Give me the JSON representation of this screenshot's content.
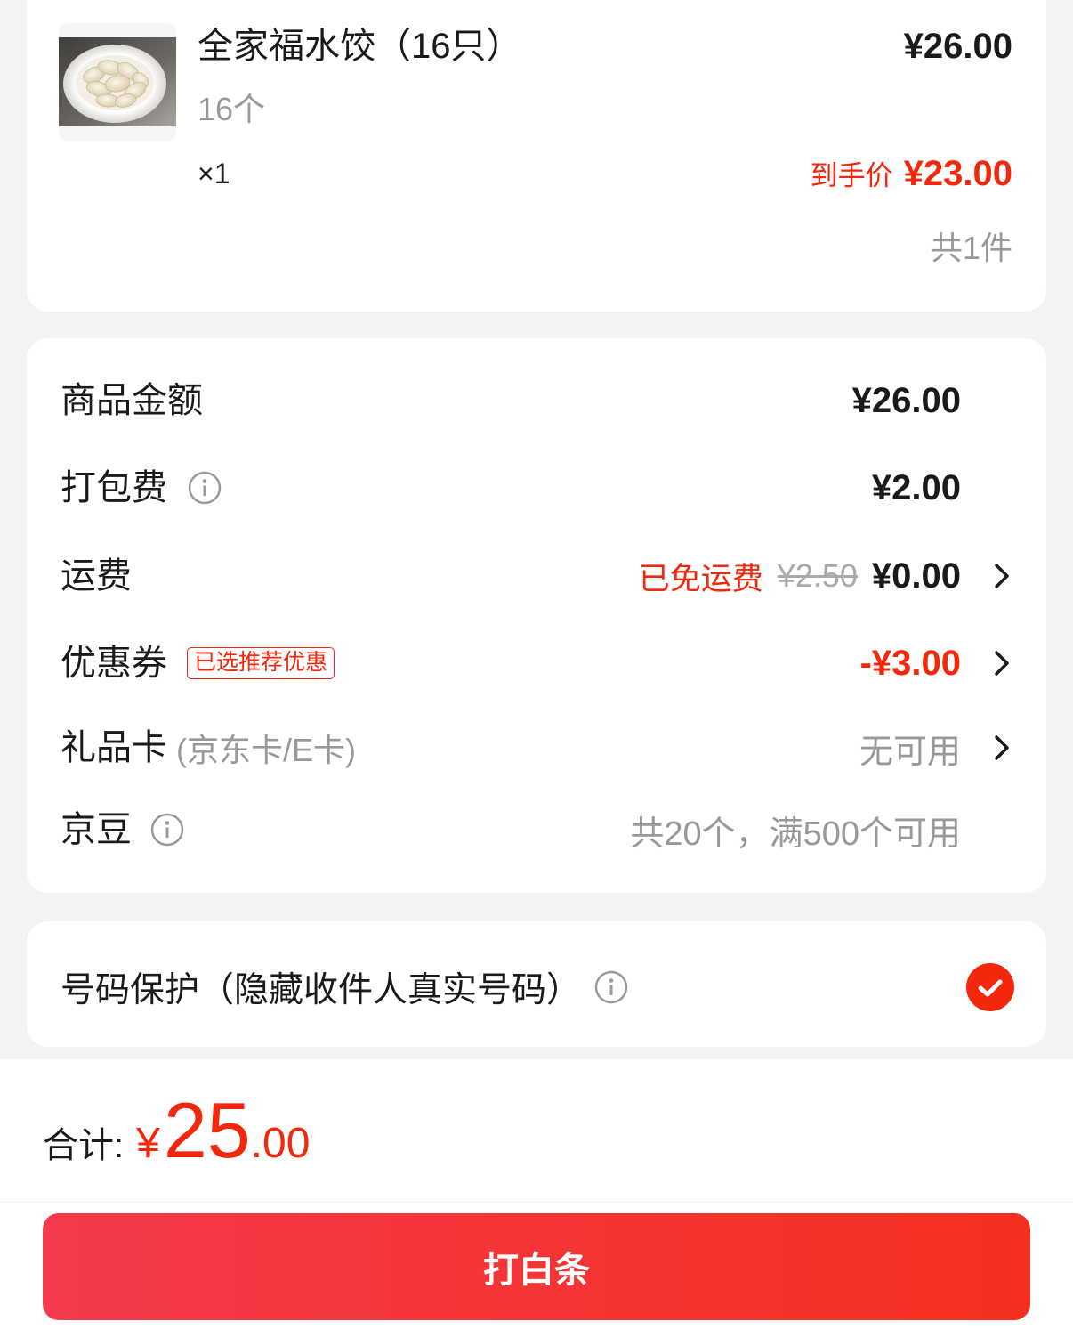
{
  "product": {
    "image_icon": "dumpling-plate-image",
    "name": "全家福水饺（16只）",
    "price": "¥26.00",
    "spec": "16个",
    "quantity": "×1",
    "final_price_label": "到手价",
    "final_price": "¥23.00",
    "item_count": "共1件"
  },
  "summary": {
    "goods_amount": {
      "label": "商品金额",
      "value": "¥26.00"
    },
    "packing_fee": {
      "label": "打包费",
      "value": "¥2.00",
      "icon": "info-icon"
    },
    "shipping": {
      "label": "运费",
      "free_tag": "已免运费",
      "original_value": "¥2.50",
      "value": "¥0.00",
      "icon": "chevron-right-icon"
    },
    "coupon": {
      "label": "优惠券",
      "badge": "已选推荐优惠",
      "value": "-¥3.00",
      "icon": "chevron-right-icon"
    },
    "gift_card": {
      "label": "礼品卡",
      "sublabel": "(京东卡/E卡)",
      "value": "无可用",
      "icon": "chevron-right-icon"
    },
    "jd_beans": {
      "label": "京豆",
      "value": "共20个，满500个可用",
      "icon": "info-icon"
    }
  },
  "privacy": {
    "label": "号码保护（隐藏收件人真实号码）",
    "info_icon": "info-icon",
    "checkbox_icon": "check-icon",
    "checked": true
  },
  "footer": {
    "total_label": "合计:",
    "currency": "¥",
    "total_integer": "25",
    "total_decimal": ".00",
    "pay_button": "打白条"
  },
  "colors": {
    "accent_red": "#f2270c",
    "text": "#1a1a1a",
    "muted": "#999999",
    "page_bg": "#f3f3f3",
    "button_gradient": [
      "#f43a4c",
      "#f5301f"
    ]
  }
}
